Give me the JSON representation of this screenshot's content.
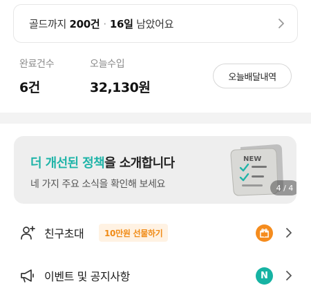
{
  "gold_progress": {
    "prefix": "골드까지",
    "count_value": "200건",
    "days_value": "16일",
    "suffix": "남았어요",
    "chevron_icon": "chevron-right-icon"
  },
  "stats": {
    "completed_label": "완료건수",
    "completed_value": "6건",
    "income_label": "오늘수입",
    "income_value": "32,130원",
    "history_button": "오늘배달내역"
  },
  "banner": {
    "title_highlight": "더 개선된 정책",
    "title_rest": "을 소개합니다",
    "subtitle": "네 가지 주요 소식을 확인해 보세요",
    "illustration_tag": "NEW",
    "page_indicator": "4 / 4",
    "accent_color": "#1fb4a8"
  },
  "menu": {
    "invite": {
      "label": "친구초대",
      "badge": "10만원 선물하기",
      "icon": "add-person-icon",
      "right_icon": "gift-icon"
    },
    "event": {
      "label": "이벤트 및 공지사항",
      "icon": "megaphone-icon",
      "new_badge": "N"
    }
  },
  "colors": {
    "teal": "#16b3a3",
    "orange": "#f58c1e",
    "band": "#f3f3f3"
  }
}
